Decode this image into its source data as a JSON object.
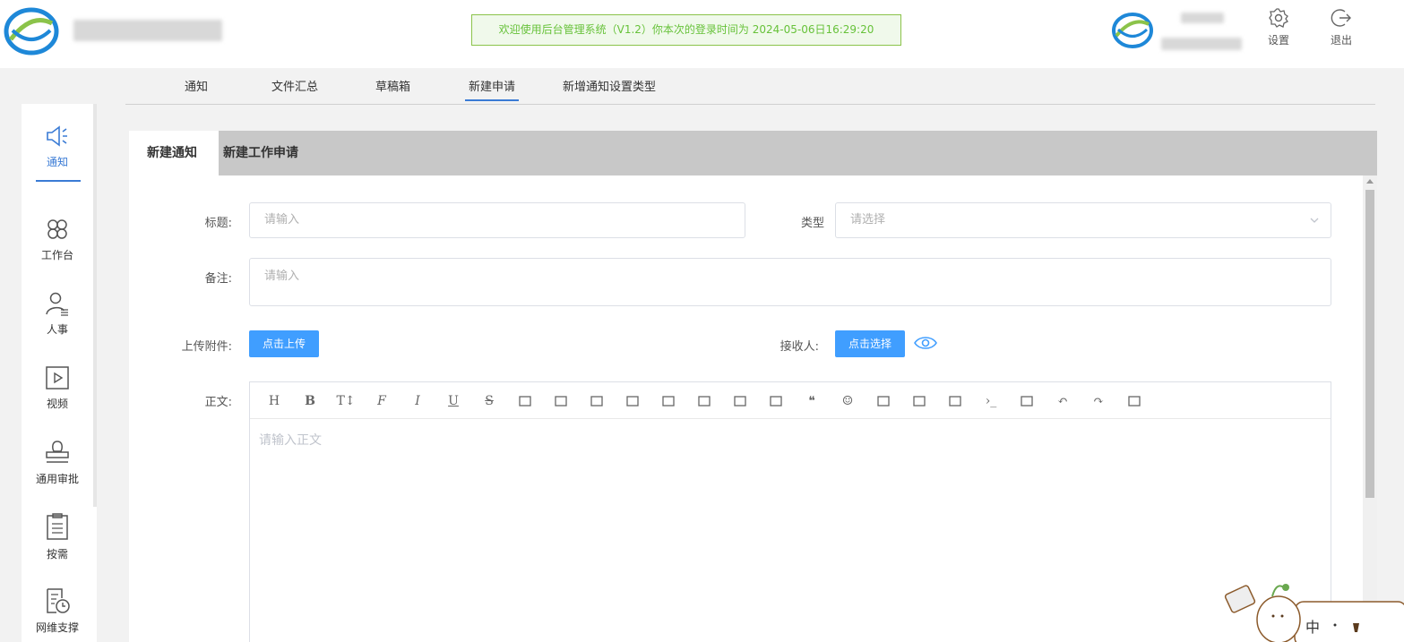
{
  "header": {
    "welcome": "欢迎使用后台管理系统（V1.2）你本次的登录时间为 2024-05-06日16:29:20",
    "settings_label": "设置",
    "logout_label": "退出",
    "icons": {
      "settings": "gear-icon",
      "logout": "logout-icon"
    }
  },
  "topnav": {
    "tabs": [
      {
        "label": "通知"
      },
      {
        "label": "文件汇总"
      },
      {
        "label": "草稿箱"
      },
      {
        "label": "新建申请",
        "active": true
      },
      {
        "label": "新增通知设置类型"
      }
    ]
  },
  "sidebar": {
    "items": [
      {
        "label": "通知",
        "icon": "megaphone-icon",
        "active": true
      },
      {
        "label": "工作台",
        "icon": "clover-icon"
      },
      {
        "label": "人事",
        "icon": "user-list-icon"
      },
      {
        "label": "视频",
        "icon": "video-icon"
      },
      {
        "label": "通用审批",
        "icon": "stamp-icon"
      },
      {
        "label": "按需",
        "icon": "clipboard-icon"
      },
      {
        "label": "网维支撑",
        "icon": "document-clock-icon"
      }
    ]
  },
  "panel": {
    "tabs": [
      {
        "label": "新建通知",
        "active": true
      },
      {
        "label": "新建工作申请"
      }
    ]
  },
  "form": {
    "title_label": "标题:",
    "title_placeholder": "请输入",
    "type_label": "类型",
    "type_placeholder": "请选择",
    "remark_label": "备注:",
    "remark_placeholder": "请输入",
    "attach_label": "上传附件:",
    "upload_button": "点击上传",
    "receiver_label": "接收人:",
    "select_button": "点击选择",
    "body_label": "正文:",
    "body_placeholder": "请输入正文"
  },
  "editor": {
    "tools": [
      "heading-icon",
      "bold-icon",
      "text-size-icon",
      "font-icon",
      "italic-icon",
      "underline-icon",
      "strikethrough-icon",
      "indent-icon",
      "line-height-icon",
      "pen-icon",
      "brush-icon",
      "link-icon",
      "bullet-list-icon",
      "checkbox-icon",
      "align-icon",
      "quote-icon",
      "emoji-icon",
      "image-icon",
      "video-icon",
      "table-icon",
      "code-icon",
      "divider-icon",
      "undo-icon",
      "redo-icon",
      "fullscreen-icon"
    ],
    "glyphs": [
      "H",
      "B",
      "T↕",
      "F",
      "I",
      "U",
      "S",
      "",
      "",
      "",
      "",
      "",
      "",
      "",
      "",
      "❝",
      "☺",
      "",
      "",
      "",
      "›_",
      "",
      "↶",
      "↷",
      ""
    ]
  },
  "mascot": {
    "text": "中"
  },
  "colors": {
    "accent": "#3a7bd5",
    "button": "#409eff",
    "welcome_border": "#8bc34a",
    "welcome_text": "#67c23a"
  }
}
